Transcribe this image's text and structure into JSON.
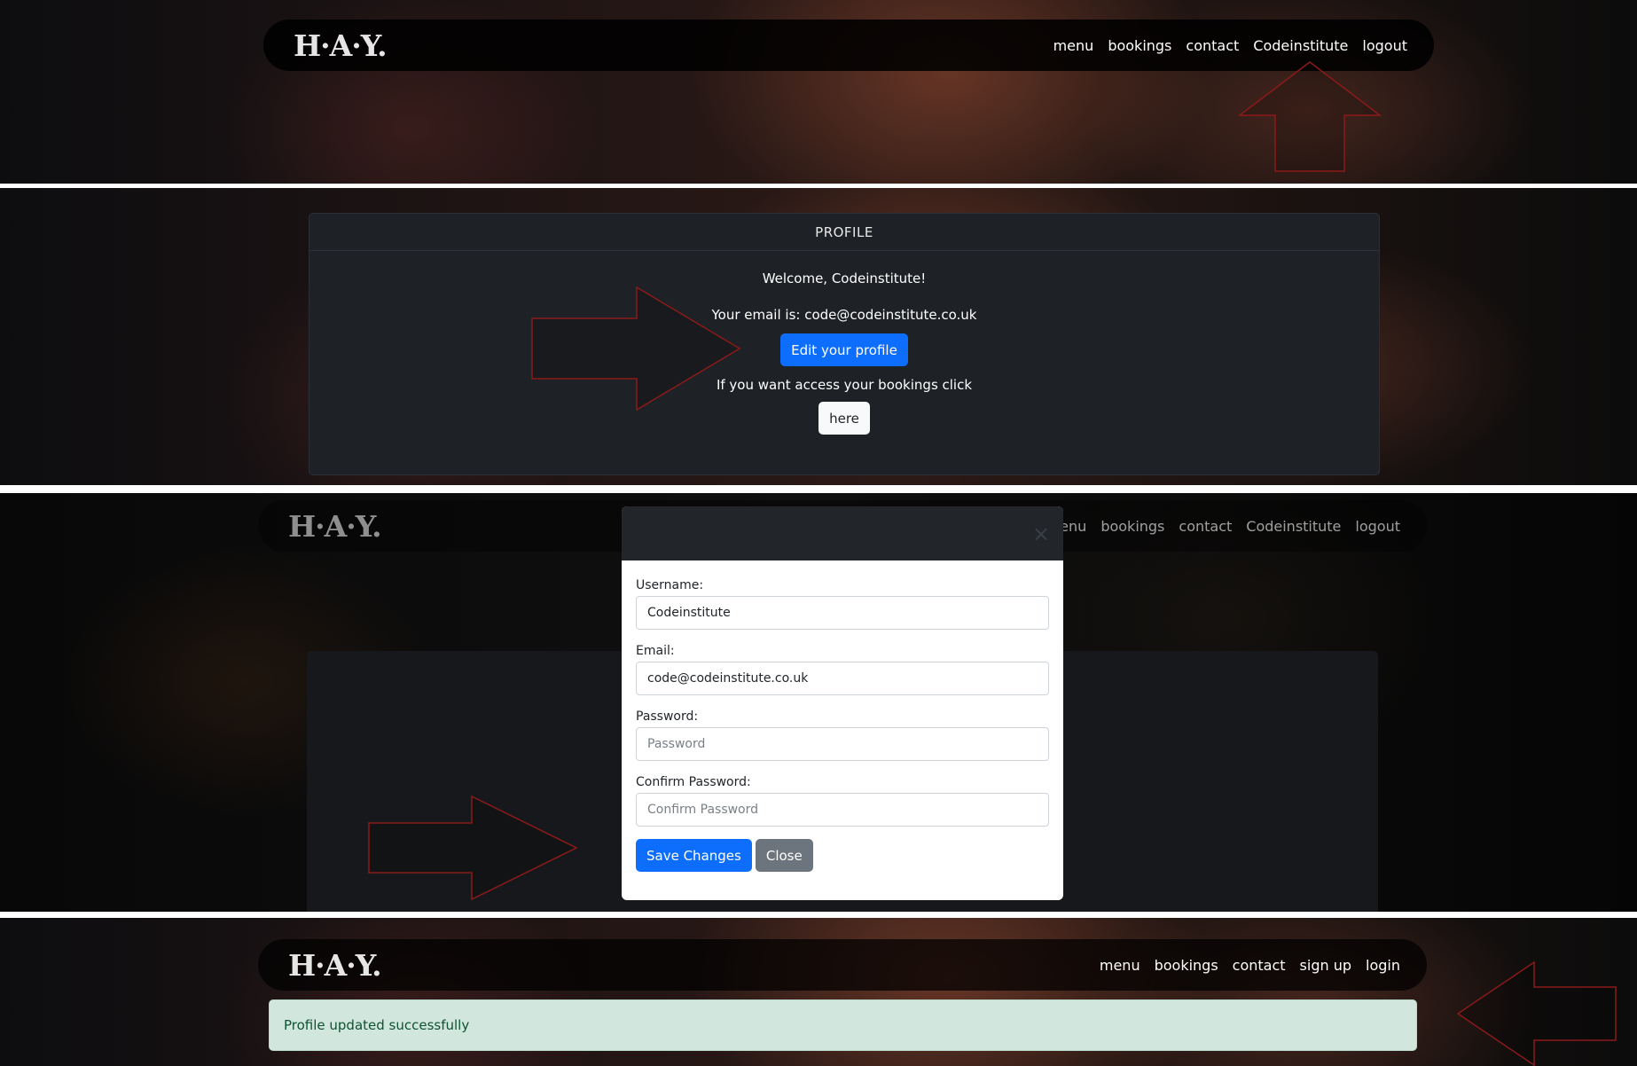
{
  "brand": {
    "logo_text": "H·A·Y."
  },
  "nav_logged_in": {
    "items": [
      "menu",
      "bookings",
      "contact",
      "Codeinstitute",
      "logout"
    ]
  },
  "nav_logged_out": {
    "items": [
      "menu",
      "bookings",
      "contact",
      "sign up",
      "login"
    ]
  },
  "profile": {
    "header": "PROFILE",
    "welcome": "Welcome, Codeinstitute!",
    "email_line": "Your email is: code@codeinstitute.co.uk",
    "edit_button": "Edit your profile",
    "bookings_text": "If you want access your bookings click",
    "here_button": "here"
  },
  "edit_modal": {
    "close_glyph": "×",
    "username_label": "Username:",
    "username_value": "Codeinstitute",
    "email_label": "Email:",
    "email_value": "code@codeinstitute.co.uk",
    "password_label": "Password:",
    "password_placeholder": "Password",
    "confirm_label": "Confirm Password:",
    "confirm_placeholder": "Confirm Password",
    "save_button": "Save Changes",
    "close_button": "Close"
  },
  "alert": {
    "message": "Profile updated successfully"
  },
  "colors": {
    "primary": "#0d6efd",
    "secondary": "#6c757d",
    "alert_bg": "#d1e7dd",
    "arrow": "#8b1a1a"
  },
  "icons": {
    "annotation": "arrow-outline-icon",
    "close": "close-icon"
  }
}
